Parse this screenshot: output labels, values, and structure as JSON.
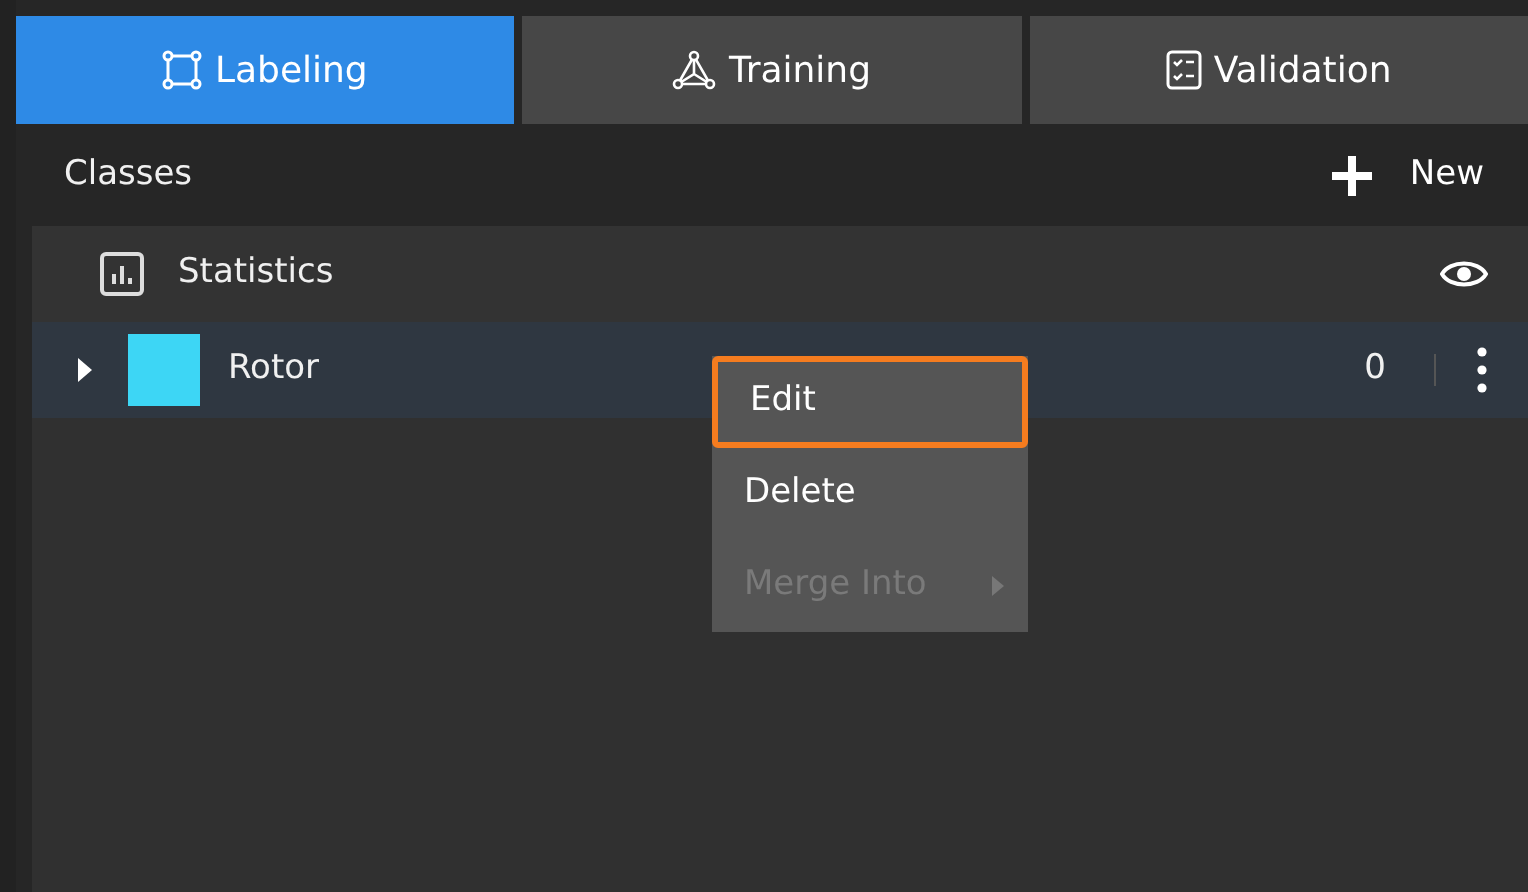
{
  "tabs": [
    {
      "label": "Labeling",
      "selected": true
    },
    {
      "label": "Training",
      "selected": false
    },
    {
      "label": "Validation",
      "selected": false
    }
  ],
  "classes_header": {
    "title": "Classes",
    "new_button": "New"
  },
  "statistics": {
    "label": "Statistics"
  },
  "class_rows": [
    {
      "name": "Rotor",
      "color": "#3dd6f5",
      "count": "0",
      "expanded": false
    }
  ],
  "context_menu": {
    "items": [
      {
        "label": "Edit",
        "disabled": false,
        "highlighted": true,
        "submenu": false
      },
      {
        "label": "Delete",
        "disabled": false,
        "highlighted": false,
        "submenu": false
      },
      {
        "label": "Merge Into",
        "disabled": true,
        "highlighted": false,
        "submenu": true
      }
    ]
  }
}
